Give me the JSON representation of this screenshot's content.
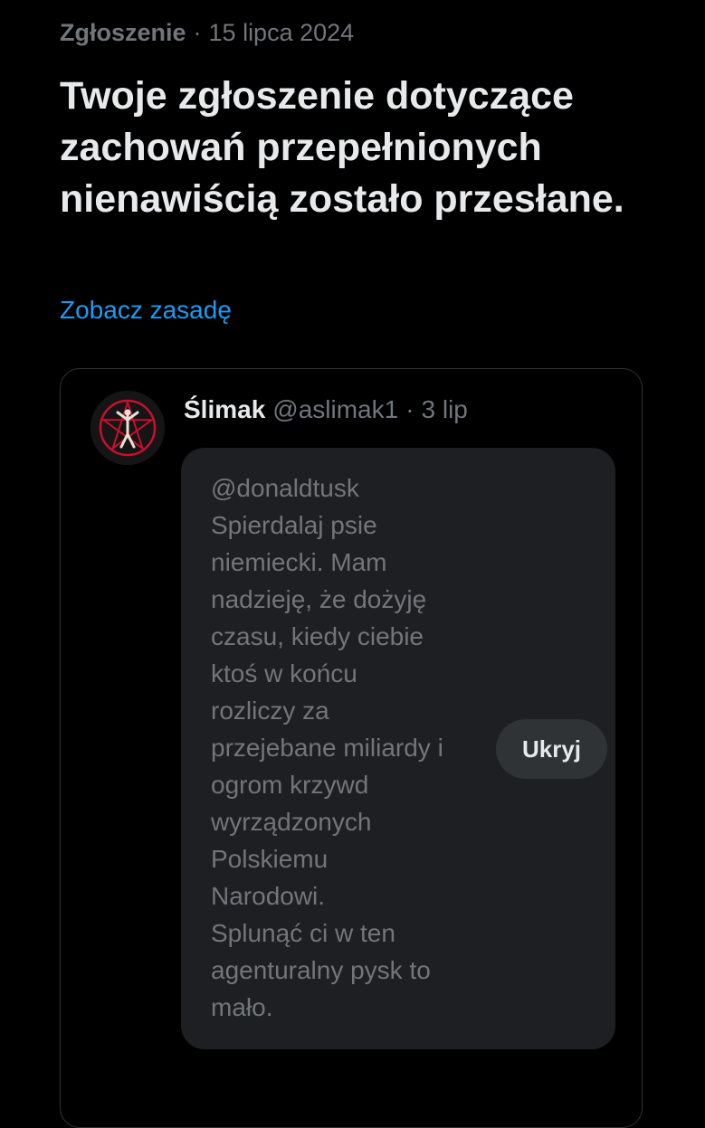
{
  "report": {
    "category": "Zgłoszenie",
    "separator": "·",
    "date": "15 lipca 2024",
    "title": "Twoje zgłoszenie dotyczące zachowań przepełnionych nienawiścią zostało przesłane.",
    "policy_link": "Zobacz zasadę"
  },
  "reported_post": {
    "display_name": "Ślimak",
    "handle": "@aslimak1",
    "separator": "·",
    "time": "3 lip",
    "text": "@donaldtusk\nSpierdalaj psie\nniemiecki. Mam\nnadzieję, że dożyję\nczasu, kiedy ciebie\nktoś w końcu\nrozliczy za\nprzejebane miliardy i\nogrom krzywd\nwyrządzonych\nPolskiemu\nNarodowi.\nSplunąć ci w ten\nagenturalny pysk to\nmało.",
    "hide_label": "Ukryj",
    "avatar_icon": "pentagram-avatar-icon"
  },
  "colors": {
    "background": "#000000",
    "primary_text": "#e7e9ea",
    "secondary_text": "#71767b",
    "link": "#1d9bf0",
    "bubble": "#1e1f22",
    "border": "#2f3336",
    "avatar_accent": "#c8102e"
  }
}
